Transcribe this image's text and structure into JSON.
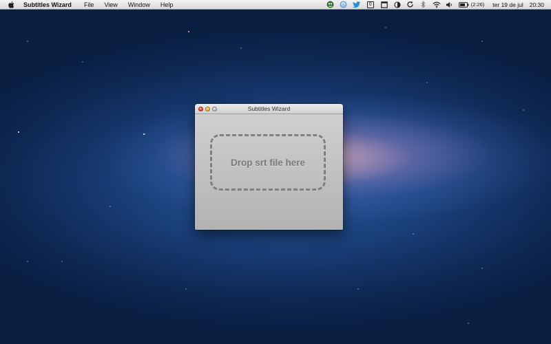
{
  "menubar": {
    "apple_icon": "apple-icon",
    "app_name": "Subtitles Wizard",
    "items": [
      {
        "label": "File"
      },
      {
        "label": "View"
      },
      {
        "label": "Window"
      },
      {
        "label": "Help"
      }
    ]
  },
  "status": {
    "icons": [
      "growl-icon",
      "sync-icon",
      "twitter-icon",
      "counter-badge-icon",
      "window-icon",
      "half-circle-icon",
      "refresh-icon",
      "bluetooth-icon",
      "wifi-icon",
      "volume-icon",
      "battery-icon"
    ],
    "counter_badge": "0",
    "battery_time": "(2:26)",
    "date": "ter 19 de jul",
    "time": "20:30"
  },
  "window": {
    "title": "Subtitles Wizard",
    "drop_label": "Drop srt file here"
  },
  "colors": {
    "close": "#e0443a",
    "minimize": "#e8b22a",
    "zoom": "#bdbdbd",
    "drop_border": "#7f7f7f"
  }
}
